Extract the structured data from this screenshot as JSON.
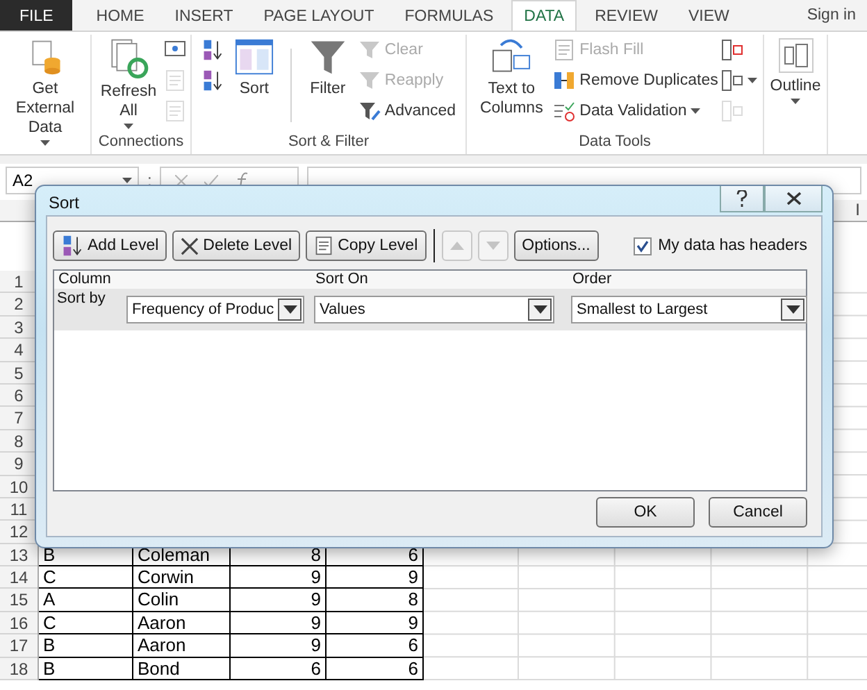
{
  "tabs": [
    {
      "label": "FILE",
      "kind": "file",
      "selected": false
    },
    {
      "label": "HOME",
      "kind": "tab",
      "selected": false
    },
    {
      "label": "INSERT",
      "kind": "tab",
      "selected": false
    },
    {
      "label": "PAGE LAYOUT",
      "kind": "tab",
      "selected": false
    },
    {
      "label": "FORMULAS",
      "kind": "tab",
      "selected": false
    },
    {
      "label": "DATA",
      "kind": "tab",
      "selected": true
    },
    {
      "label": "REVIEW",
      "kind": "tab",
      "selected": false
    },
    {
      "label": "VIEW",
      "kind": "tab",
      "selected": false
    }
  ],
  "sign_in": "Sign in",
  "ribbon_groups": [
    {
      "kind": "external",
      "items": [
        {
          "kind": "large",
          "label": "Get External Data",
          "dropdown": true
        }
      ]
    },
    {
      "kind": "connections",
      "label": "Connections",
      "items": [
        {
          "kind": "large",
          "label": "Refresh All",
          "dropdown": true
        },
        {
          "kind": "stack",
          "buttons": [
            {
              "disabled": false
            },
            {
              "disabled": true
            },
            {
              "disabled": true
            }
          ]
        }
      ]
    },
    {
      "kind": "sort",
      "label": "Sort & Filter",
      "items": [
        {
          "kind": "stack",
          "buttons": [
            {
              "disabled": false
            },
            {
              "disabled": false
            }
          ]
        },
        {
          "kind": "large",
          "label": "Sort",
          "dropdown": false
        },
        {
          "kind": "separator"
        },
        {
          "kind": "large",
          "label": "Filter",
          "dropdown": false
        },
        {
          "kind": "stack",
          "buttons": [
            {
              "label": "Clear",
              "disabled": true
            },
            {
              "label": "Reapply",
              "disabled": true
            },
            {
              "label": "Advanced",
              "disabled": false
            }
          ]
        }
      ]
    },
    {
      "kind": "tools",
      "label": "Data Tools",
      "items": [
        {
          "kind": "large",
          "label": "Text to Columns",
          "dropdown": false
        },
        {
          "kind": "stack",
          "buttons": [
            {
              "label": "Flash Fill",
              "disabled": true
            },
            {
              "label": "Remove Duplicates",
              "disabled": false
            },
            {
              "label": "Data Validation",
              "disabled": false,
              "dropdown": true
            }
          ]
        },
        {
          "kind": "stack",
          "buttons": [
            {
              "disabled": false
            },
            {
              "disabled": false,
              "dropdown": true
            },
            {
              "disabled": true
            }
          ]
        }
      ]
    },
    {
      "kind": "outline",
      "items": [
        {
          "kind": "large",
          "label": "Outline",
          "dropdown": true
        }
      ]
    }
  ],
  "formula_bar": {
    "name_box": "A2",
    "separator": ":"
  },
  "sheet": {
    "column_headers": [
      {
        "label": "I"
      }
    ],
    "row_numbers": [
      "1",
      "2",
      "3",
      "4",
      "5",
      "6",
      "7",
      "8",
      "9",
      "10",
      "11",
      "12",
      "13",
      "14",
      "15",
      "16",
      "17",
      "18"
    ],
    "rows": [
      {
        "cells": [
          "B",
          "Coleman",
          "8",
          "6"
        ]
      },
      {
        "cells": [
          "C",
          "Corwin",
          "9",
          "9"
        ]
      },
      {
        "cells": [
          "A",
          "Colin",
          "9",
          "8"
        ]
      },
      {
        "cells": [
          "C",
          "Aaron",
          "9",
          "9"
        ]
      },
      {
        "cells": [
          "B",
          "Aaron",
          "9",
          "6"
        ]
      },
      {
        "cells": [
          "B",
          "Bond",
          "6",
          "6"
        ]
      }
    ]
  },
  "dialog": {
    "title": "Sort",
    "toolbar": [
      {
        "kind": "button",
        "label": "Add Level"
      },
      {
        "kind": "button",
        "label": "Delete Level"
      },
      {
        "kind": "button",
        "label": "Copy Level"
      },
      {
        "kind": "up",
        "disabled": true
      },
      {
        "kind": "down",
        "disabled": true
      },
      {
        "kind": "button",
        "label": "Options..."
      }
    ],
    "headers_checkbox": {
      "label": "My data has headers",
      "checked": true
    },
    "columns": [
      "Column",
      "Sort On",
      "Order"
    ],
    "levels": [
      {
        "label": "Sort by",
        "column": "Frequency of Produc",
        "sort_on": "Values",
        "order": "Smallest to Largest",
        "selected": true
      }
    ],
    "buttons": [
      "OK",
      "Cancel"
    ]
  }
}
